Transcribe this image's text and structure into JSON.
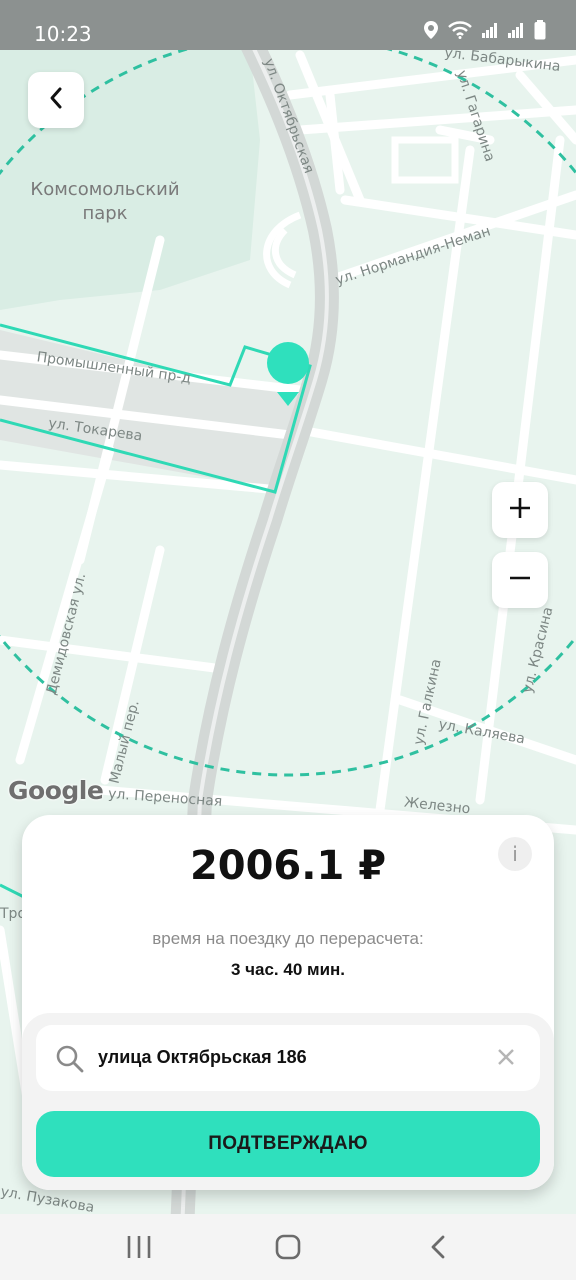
{
  "status_bar": {
    "time": "10:23"
  },
  "map": {
    "park_label": "Комсомольский парк",
    "streets": {
      "babarykina": "ул. Бабарыкина",
      "oktyabrskaya": "ул. Октябрьская",
      "gagarina": "ул. Гагарина",
      "normandiya": "ул. Нормандия-Неман",
      "promyshlenny": "Промышленный пр-д",
      "tokareva": "ул. Токарева",
      "demidovskaya": "Демидовская ул.",
      "maly": "Малый пер.",
      "perenosnaya": "ул. Переносная",
      "zhelezno": "Железно",
      "galkina": "ул. Галкина",
      "kalyaeva": "ул. Каляева",
      "krasina": "ул. Красина",
      "pugachova": "ул. Пузакова",
      "tro": "Тро"
    },
    "google_label": "Google",
    "accent_color": "#2fd9b5"
  },
  "icons": {
    "back": "chevron-left-icon",
    "zoom_in": "plus-icon",
    "zoom_out": "minus-icon",
    "info": "info-icon",
    "search": "search-icon",
    "clear": "close-icon"
  },
  "sheet": {
    "price": "2006.1 ₽",
    "info_symbol": "i",
    "trip_caption": "время на поездку до перерасчета:",
    "trip_time": "3 час. 40 мин.",
    "address": "улица Октябрьская 186",
    "confirm_label": "ПОДТВЕРЖДАЮ",
    "confirm_color": "#2fe0bd"
  }
}
